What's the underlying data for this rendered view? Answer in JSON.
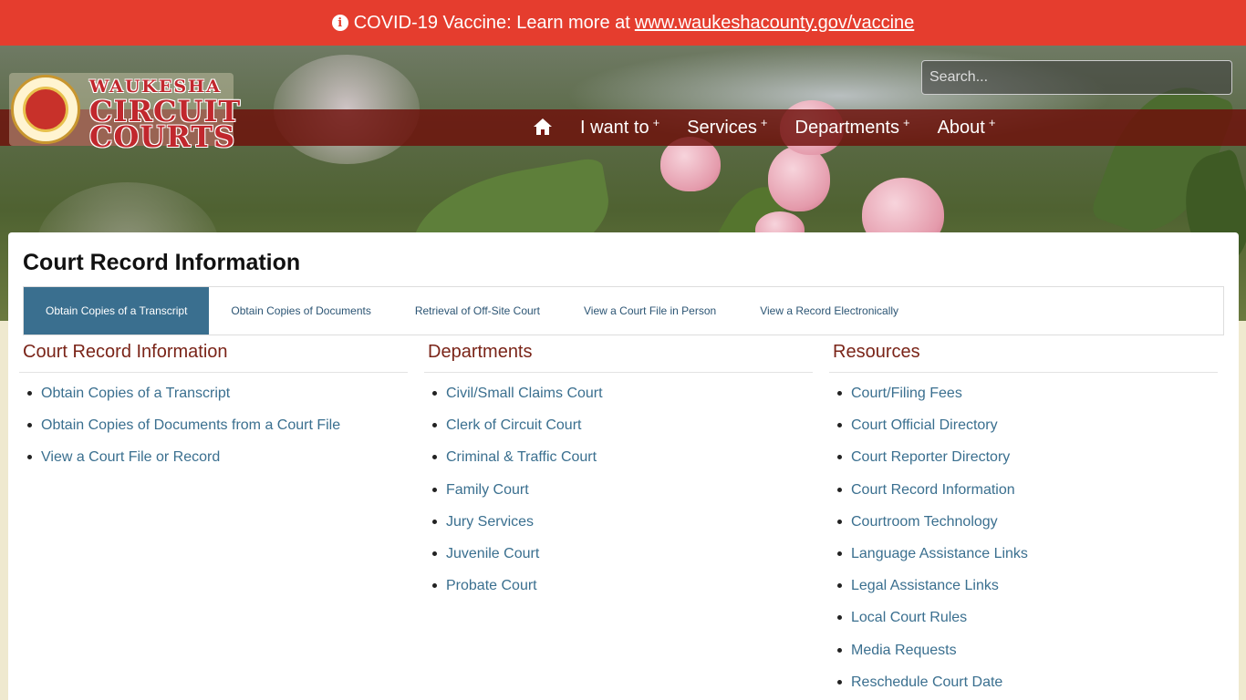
{
  "alert": {
    "text": "COVID-19 Vaccine: Learn more at",
    "link": "www.waukeshacounty.gov/vaccine"
  },
  "header": {
    "logo": {
      "line1": "WAUKESHA",
      "line2": "CIRCUIT",
      "line3": "COURTS"
    },
    "search_placeholder": "Search...",
    "nav": [
      {
        "label": "I want to",
        "suffix": "+"
      },
      {
        "label": "Services",
        "suffix": "+"
      },
      {
        "label": "Departments",
        "suffix": "+"
      },
      {
        "label": "About",
        "suffix": "+"
      }
    ]
  },
  "main": {
    "title": "Court Record Information",
    "tabs": [
      "Obtain Copies of a Transcript",
      "Obtain Copies of Documents",
      "Retrieval of Off-Site Court",
      "View a Court File in Person",
      "View a Record Electronically"
    ],
    "columns": [
      {
        "heading": "Court Record Information",
        "items": [
          "Obtain Copies of a Transcript",
          "Obtain Copies of Documents from a Court File",
          "View a Court File or Record"
        ]
      },
      {
        "heading": "Departments",
        "items": [
          "Civil/Small Claims Court",
          "Clerk of Circuit Court",
          "Criminal & Traffic Court",
          "Family Court",
          "Jury Services",
          "Juvenile Court",
          "Probate Court"
        ]
      },
      {
        "heading": "Resources",
        "items": [
          "Court/Filing Fees",
          "Court Official Directory",
          "Court Reporter Directory",
          "Court Record Information",
          "Courtroom Technology",
          "Language Assistance Links",
          "Legal Assistance Links",
          "Local Court Rules",
          "Media Requests",
          "Reschedule Court Date"
        ]
      }
    ]
  },
  "colors": {
    "alert": "#e53d2e",
    "nav_bar": "#6e0f0a",
    "accent": "#3a6f8f",
    "heading": "#7a2418"
  }
}
